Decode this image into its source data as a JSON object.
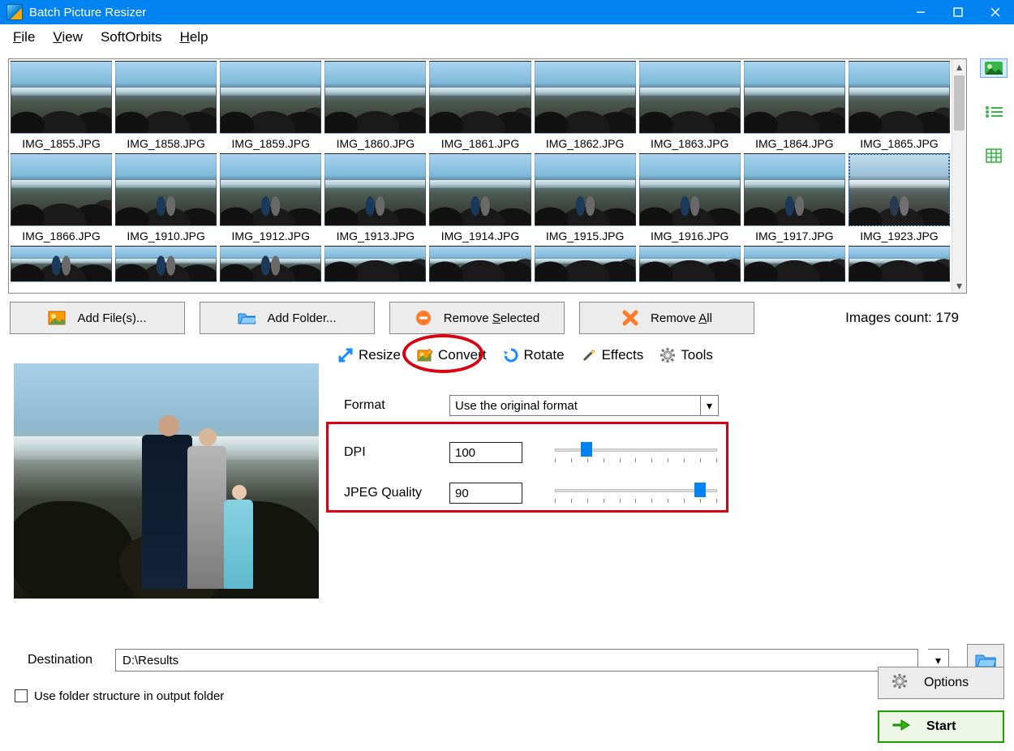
{
  "window": {
    "title": "Batch Picture Resizer"
  },
  "menu": {
    "file": "File",
    "view": "View",
    "softorbits": "SoftOrbits",
    "help": "Help"
  },
  "thumbs": [
    {
      "label": "IMG_1855.JPG"
    },
    {
      "label": "IMG_1858.JPG"
    },
    {
      "label": "IMG_1859.JPG"
    },
    {
      "label": "IMG_1860.JPG"
    },
    {
      "label": "IMG_1861.JPG"
    },
    {
      "label": "IMG_1862.JPG"
    },
    {
      "label": "IMG_1863.JPG"
    },
    {
      "label": "IMG_1864.JPG"
    },
    {
      "label": "IMG_1865.JPG"
    },
    {
      "label": "IMG_1866.JPG"
    },
    {
      "label": "IMG_1910.JPG"
    },
    {
      "label": "IMG_1912.JPG"
    },
    {
      "label": "IMG_1913.JPG"
    },
    {
      "label": "IMG_1914.JPG"
    },
    {
      "label": "IMG_1915.JPG"
    },
    {
      "label": "IMG_1916.JPG"
    },
    {
      "label": "IMG_1917.JPG"
    },
    {
      "label": "IMG_1923.JPG",
      "selected": true
    }
  ],
  "toolbar": {
    "addfiles": "Add File(s)...",
    "addfolder": "Add Folder...",
    "removesel": "Remove Selected",
    "removeall": "Remove All",
    "count_prefix": "Images count: ",
    "count": "179"
  },
  "tabs": {
    "resize": "Resize",
    "convert": "Convert",
    "rotate": "Rotate",
    "effects": "Effects",
    "tools": "Tools",
    "active": "convert"
  },
  "convert": {
    "format_label": "Format",
    "format_value": "Use the original format",
    "dpi_label": "DPI",
    "dpi_value": "100",
    "jpegq_label": "JPEG Quality",
    "jpegq_value": "90"
  },
  "dest": {
    "label": "Destination",
    "value": "D:\\Results",
    "usefolder": "Use folder structure in output folder"
  },
  "buttons": {
    "options": "Options",
    "start": "Start"
  }
}
